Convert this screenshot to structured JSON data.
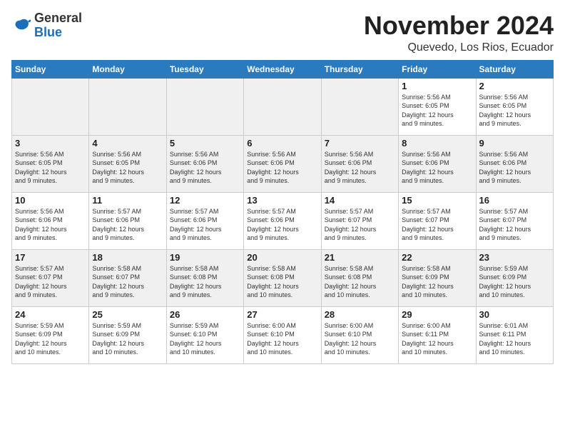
{
  "header": {
    "logo_general": "General",
    "logo_blue": "Blue",
    "month_year": "November 2024",
    "location": "Quevedo, Los Rios, Ecuador"
  },
  "weekdays": [
    "Sunday",
    "Monday",
    "Tuesday",
    "Wednesday",
    "Thursday",
    "Friday",
    "Saturday"
  ],
  "weeks": [
    [
      {
        "day": "",
        "info": ""
      },
      {
        "day": "",
        "info": ""
      },
      {
        "day": "",
        "info": ""
      },
      {
        "day": "",
        "info": ""
      },
      {
        "day": "",
        "info": ""
      },
      {
        "day": "1",
        "info": "Sunrise: 5:56 AM\nSunset: 6:05 PM\nDaylight: 12 hours\nand 9 minutes."
      },
      {
        "day": "2",
        "info": "Sunrise: 5:56 AM\nSunset: 6:05 PM\nDaylight: 12 hours\nand 9 minutes."
      }
    ],
    [
      {
        "day": "3",
        "info": "Sunrise: 5:56 AM\nSunset: 6:05 PM\nDaylight: 12 hours\nand 9 minutes."
      },
      {
        "day": "4",
        "info": "Sunrise: 5:56 AM\nSunset: 6:05 PM\nDaylight: 12 hours\nand 9 minutes."
      },
      {
        "day": "5",
        "info": "Sunrise: 5:56 AM\nSunset: 6:06 PM\nDaylight: 12 hours\nand 9 minutes."
      },
      {
        "day": "6",
        "info": "Sunrise: 5:56 AM\nSunset: 6:06 PM\nDaylight: 12 hours\nand 9 minutes."
      },
      {
        "day": "7",
        "info": "Sunrise: 5:56 AM\nSunset: 6:06 PM\nDaylight: 12 hours\nand 9 minutes."
      },
      {
        "day": "8",
        "info": "Sunrise: 5:56 AM\nSunset: 6:06 PM\nDaylight: 12 hours\nand 9 minutes."
      },
      {
        "day": "9",
        "info": "Sunrise: 5:56 AM\nSunset: 6:06 PM\nDaylight: 12 hours\nand 9 minutes."
      }
    ],
    [
      {
        "day": "10",
        "info": "Sunrise: 5:56 AM\nSunset: 6:06 PM\nDaylight: 12 hours\nand 9 minutes."
      },
      {
        "day": "11",
        "info": "Sunrise: 5:57 AM\nSunset: 6:06 PM\nDaylight: 12 hours\nand 9 minutes."
      },
      {
        "day": "12",
        "info": "Sunrise: 5:57 AM\nSunset: 6:06 PM\nDaylight: 12 hours\nand 9 minutes."
      },
      {
        "day": "13",
        "info": "Sunrise: 5:57 AM\nSunset: 6:06 PM\nDaylight: 12 hours\nand 9 minutes."
      },
      {
        "day": "14",
        "info": "Sunrise: 5:57 AM\nSunset: 6:07 PM\nDaylight: 12 hours\nand 9 minutes."
      },
      {
        "day": "15",
        "info": "Sunrise: 5:57 AM\nSunset: 6:07 PM\nDaylight: 12 hours\nand 9 minutes."
      },
      {
        "day": "16",
        "info": "Sunrise: 5:57 AM\nSunset: 6:07 PM\nDaylight: 12 hours\nand 9 minutes."
      }
    ],
    [
      {
        "day": "17",
        "info": "Sunrise: 5:57 AM\nSunset: 6:07 PM\nDaylight: 12 hours\nand 9 minutes."
      },
      {
        "day": "18",
        "info": "Sunrise: 5:58 AM\nSunset: 6:07 PM\nDaylight: 12 hours\nand 9 minutes."
      },
      {
        "day": "19",
        "info": "Sunrise: 5:58 AM\nSunset: 6:08 PM\nDaylight: 12 hours\nand 9 minutes."
      },
      {
        "day": "20",
        "info": "Sunrise: 5:58 AM\nSunset: 6:08 PM\nDaylight: 12 hours\nand 10 minutes."
      },
      {
        "day": "21",
        "info": "Sunrise: 5:58 AM\nSunset: 6:08 PM\nDaylight: 12 hours\nand 10 minutes."
      },
      {
        "day": "22",
        "info": "Sunrise: 5:58 AM\nSunset: 6:09 PM\nDaylight: 12 hours\nand 10 minutes."
      },
      {
        "day": "23",
        "info": "Sunrise: 5:59 AM\nSunset: 6:09 PM\nDaylight: 12 hours\nand 10 minutes."
      }
    ],
    [
      {
        "day": "24",
        "info": "Sunrise: 5:59 AM\nSunset: 6:09 PM\nDaylight: 12 hours\nand 10 minutes."
      },
      {
        "day": "25",
        "info": "Sunrise: 5:59 AM\nSunset: 6:09 PM\nDaylight: 12 hours\nand 10 minutes."
      },
      {
        "day": "26",
        "info": "Sunrise: 5:59 AM\nSunset: 6:10 PM\nDaylight: 12 hours\nand 10 minutes."
      },
      {
        "day": "27",
        "info": "Sunrise: 6:00 AM\nSunset: 6:10 PM\nDaylight: 12 hours\nand 10 minutes."
      },
      {
        "day": "28",
        "info": "Sunrise: 6:00 AM\nSunset: 6:10 PM\nDaylight: 12 hours\nand 10 minutes."
      },
      {
        "day": "29",
        "info": "Sunrise: 6:00 AM\nSunset: 6:11 PM\nDaylight: 12 hours\nand 10 minutes."
      },
      {
        "day": "30",
        "info": "Sunrise: 6:01 AM\nSunset: 6:11 PM\nDaylight: 12 hours\nand 10 minutes."
      }
    ]
  ]
}
